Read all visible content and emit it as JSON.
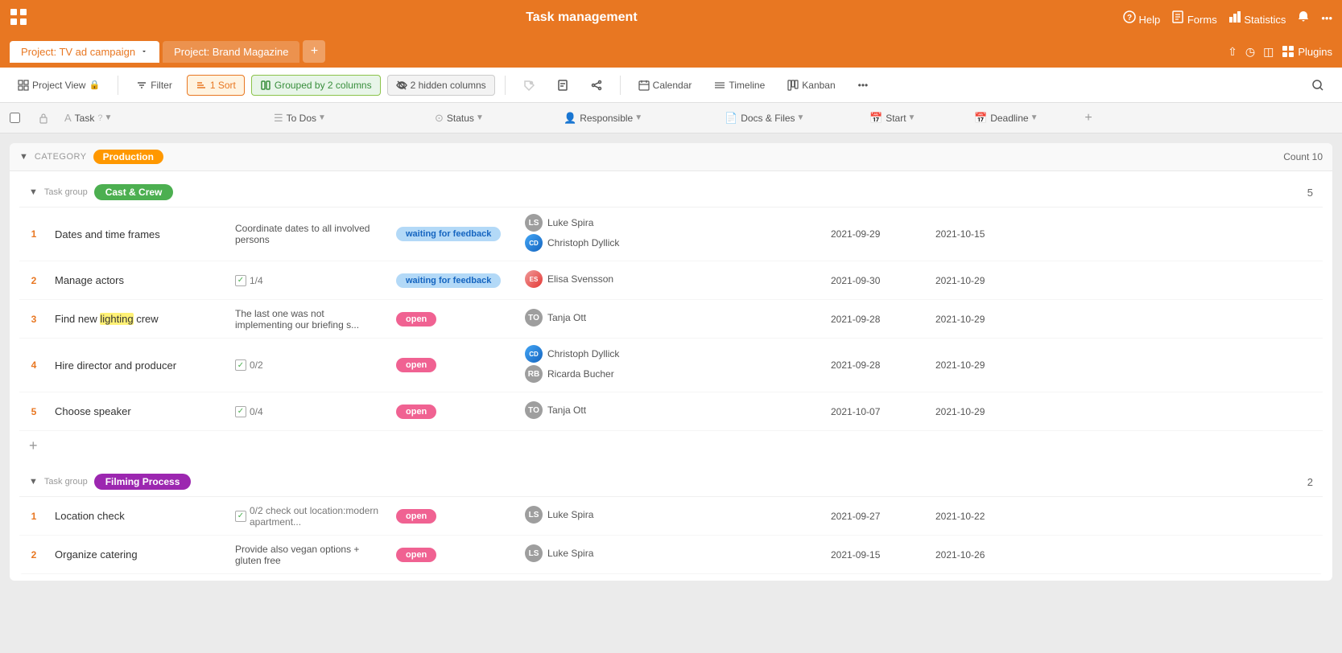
{
  "app": {
    "title": "Task management",
    "help": "Help",
    "forms": "Forms",
    "statistics": "Statistics",
    "plugins": "Plugins"
  },
  "tabs": [
    {
      "id": "tv",
      "label": "Project: TV ad campaign",
      "active": true
    },
    {
      "id": "brand",
      "label": "Project: Brand Magazine",
      "active": false
    }
  ],
  "toolbar": {
    "project_view": "Project View",
    "filter": "Filter",
    "sort": "1 Sort",
    "grouped": "Grouped by 2 columns",
    "hidden": "2 hidden columns",
    "calendar": "Calendar",
    "timeline": "Timeline",
    "kanban": "Kanban"
  },
  "columns": {
    "task": "Task",
    "todos": "To Dos",
    "status": "Status",
    "responsible": "Responsible",
    "docs": "Docs & Files",
    "start": "Start",
    "deadline": "Deadline"
  },
  "category": {
    "label": "Category",
    "name": "Production",
    "count_label": "Count",
    "count": 10
  },
  "task_groups": [
    {
      "id": "cast",
      "label": "Task group",
      "name": "Cast & Crew",
      "tag_class": "tag-cast",
      "count": 5,
      "tasks": [
        {
          "num": 1,
          "name": "Dates and time frames",
          "todos": "Coordinate dates to all involved persons",
          "todos_type": "text",
          "status": "waiting for feedback",
          "status_type": "waiting",
          "responsible": [
            {
              "name": "Luke Spira",
              "initials": "LS",
              "color": "avatar-gray"
            },
            {
              "name": "Christoph Dyllick",
              "initials": "CD",
              "color": "avatar-blue",
              "has_img": true
            }
          ],
          "start": "2021-09-29",
          "deadline": "2021-10-15"
        },
        {
          "num": 2,
          "name": "Manage actors",
          "todos": "1/4",
          "todos_type": "checkbox",
          "status": "waiting for feedback",
          "status_type": "waiting",
          "responsible": [
            {
              "name": "Elisa Svensson",
              "initials": "ES",
              "color": "avatar-blue",
              "has_img": true
            }
          ],
          "start": "2021-09-30",
          "deadline": "2021-10-29"
        },
        {
          "num": 3,
          "name": "Find new lighting crew",
          "todos": "The last one was not implementing our briefing s...",
          "todos_type": "text",
          "status": "open",
          "status_type": "open",
          "responsible": [
            {
              "name": "Tanja Ott",
              "initials": "TO",
              "color": "avatar-gray"
            }
          ],
          "start": "2021-09-28",
          "deadline": "2021-10-29"
        },
        {
          "num": 4,
          "name": "Hire director and producer",
          "todos": "0/2",
          "todos_type": "checkbox",
          "status": "open",
          "status_type": "open",
          "responsible": [
            {
              "name": "Christoph Dyllick",
              "initials": "CD",
              "color": "avatar-blue",
              "has_img": true
            },
            {
              "name": "Ricarda Bucher",
              "initials": "RB",
              "color": "avatar-gray"
            }
          ],
          "start": "2021-09-28",
          "deadline": "2021-10-29"
        },
        {
          "num": 5,
          "name": "Choose speaker",
          "todos": "0/4",
          "todos_type": "checkbox",
          "status": "open",
          "status_type": "open",
          "responsible": [
            {
              "name": "Tanja Ott",
              "initials": "TO",
              "color": "avatar-gray"
            }
          ],
          "start": "2021-10-07",
          "deadline": "2021-10-29"
        }
      ]
    },
    {
      "id": "filming",
      "label": "Task group",
      "name": "Filming Process",
      "tag_class": "tag-filming",
      "count": 2,
      "tasks": [
        {
          "num": 1,
          "name": "Location check",
          "todos": "0/2  check out location:modern apartment...",
          "todos_type": "checkbox_text",
          "status": "open",
          "status_type": "open",
          "responsible": [
            {
              "name": "Luke Spira",
              "initials": "LS",
              "color": "avatar-gray"
            }
          ],
          "start": "2021-09-27",
          "deadline": "2021-10-22"
        },
        {
          "num": 2,
          "name": "Organize catering",
          "todos": "Provide also vegan options + gluten free",
          "todos_type": "text",
          "status": "open",
          "status_type": "open",
          "responsible": [
            {
              "name": "Luke Spira",
              "initials": "LS",
              "color": "avatar-gray"
            }
          ],
          "start": "2021-09-15",
          "deadline": "2021-10-26"
        }
      ]
    }
  ]
}
